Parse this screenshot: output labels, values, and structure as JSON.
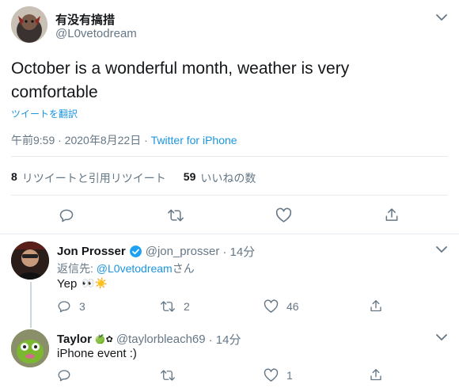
{
  "colors": {
    "accent": "#1b95e0",
    "muted": "#657786",
    "border": "#e6ecf0"
  },
  "main_tweet": {
    "display_name": "有没有搞措",
    "handle": "@L0vetodream",
    "text": "October is a wonderful month, weather is very comfortable",
    "translate_label": "ツイートを翻訳",
    "time": "午前9:59 · 2020年8月22日 · ",
    "source": "Twitter for iPhone",
    "retweets_count": "8",
    "retweets_label": "リツイートと引用リツイート",
    "likes_count": "59",
    "likes_label": "いいねの数"
  },
  "replies": [
    {
      "display_name": "Jon Prosser",
      "verified": true,
      "handle": "@jon_prosser",
      "age": "· 14分",
      "reply_to_prefix": "返信先: ",
      "reply_to_handle": "@L0vetodream",
      "reply_to_suffix": "さん",
      "text": "Yep",
      "emoji": "👀☀️",
      "reply_count": "3",
      "retweet_count": "2",
      "like_count": "46"
    },
    {
      "display_name": "Taylor",
      "name_badges": "🍏✿",
      "handle": "@taylorbleach69",
      "age": "· 14分",
      "text": "iPhone event :)",
      "like_count": "1"
    }
  ],
  "icons": [
    "chevron-down-icon",
    "reply-icon",
    "retweet-icon",
    "like-icon",
    "share-icon",
    "verified-icon"
  ]
}
